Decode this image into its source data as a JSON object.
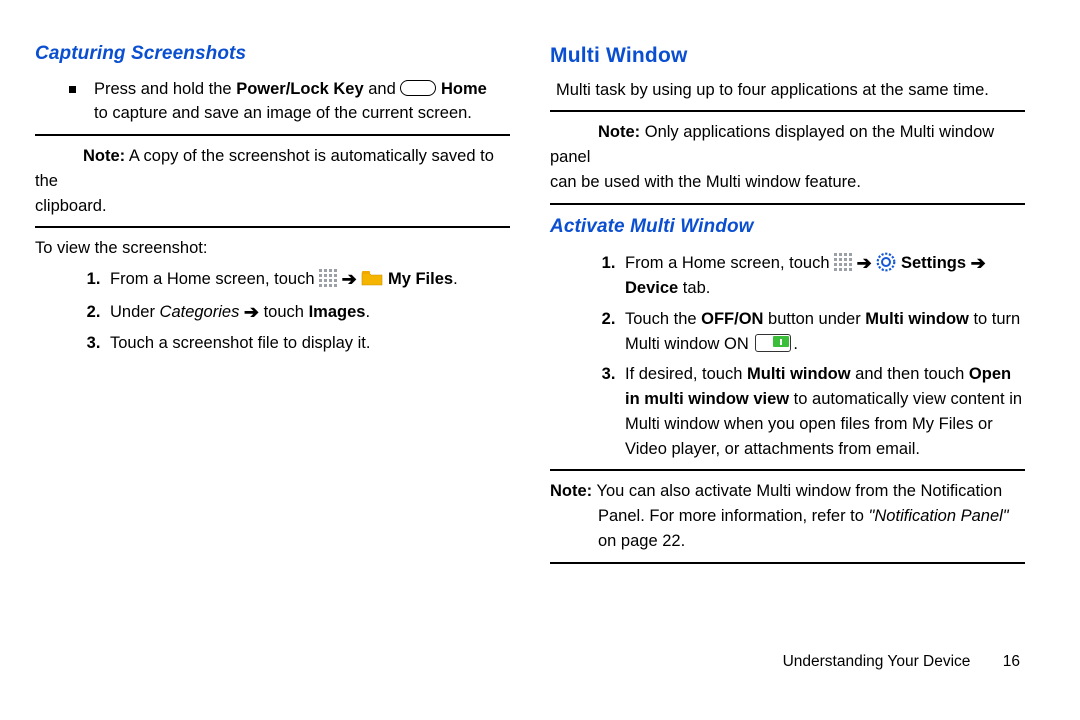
{
  "left": {
    "heading": "Capturing Screenshots",
    "bullet_pre": "Press and hold the ",
    "bullet_bold1": "Power/Lock Key",
    "bullet_mid": " and ",
    "bullet_bold2": " Home",
    "bullet_line2": "to capture and save an image of the current screen.",
    "note_label": "Note:",
    "note_body_a": " A copy of the screenshot is automatically saved to the ",
    "note_body_b": "clipboard.",
    "view_intro": "To view the screenshot:",
    "step1_pre": "From a Home screen, touch ",
    "step1_bold": " My Files",
    "step1_end": ".",
    "step2_pre": "Under ",
    "step2_italic": "Categories ",
    "step2_mid": " touch ",
    "step2_bold": "Images",
    "step2_end": ".",
    "step3": "Touch a screenshot file to display it."
  },
  "right": {
    "heading": "Multi Window",
    "intro": "Multi task by using up to four applications at the same time.",
    "note1_label": "Note:",
    "note1_a": " Only applications displayed on the Multi window panel ",
    "note1_b": "can be used with the Multi window feature.",
    "sub_heading": "Activate Multi Window",
    "s1_pre": "From a Home screen, touch ",
    "s1_bold1": " Settings ",
    "s1_bold2": "Device",
    "s1_end": " tab.",
    "s2_pre": "Touch the ",
    "s2_b1": "OFF/ON",
    "s2_mid1": " button under ",
    "s2_b2": "Multi window",
    "s2_mid2": " to turn Multi window ON ",
    "s2_end": ".",
    "s3_pre": "If desired, touch ",
    "s3_b1": "Multi window",
    "s3_mid1": " and then touch ",
    "s3_b2": "Open in multi window view",
    "s3_mid2": " to automatically view content in Multi window when you open files from My Files or Video player, or attachments from email.",
    "note2_label": "Note:",
    "note2_a": " You can also activate Multi window from the Notification Panel. For more information, refer to ",
    "note2_i": "\"Notification Panel\"",
    "note2_b": " on page 22."
  },
  "footer": {
    "section": "Understanding Your Device",
    "page": "16"
  },
  "icons": {
    "home": "home-key-icon",
    "apps": "apps-grid-icon",
    "folder": "folder-icon",
    "gear": "gear-icon",
    "arrow": "➔",
    "toggle": "toggle-on-icon"
  }
}
